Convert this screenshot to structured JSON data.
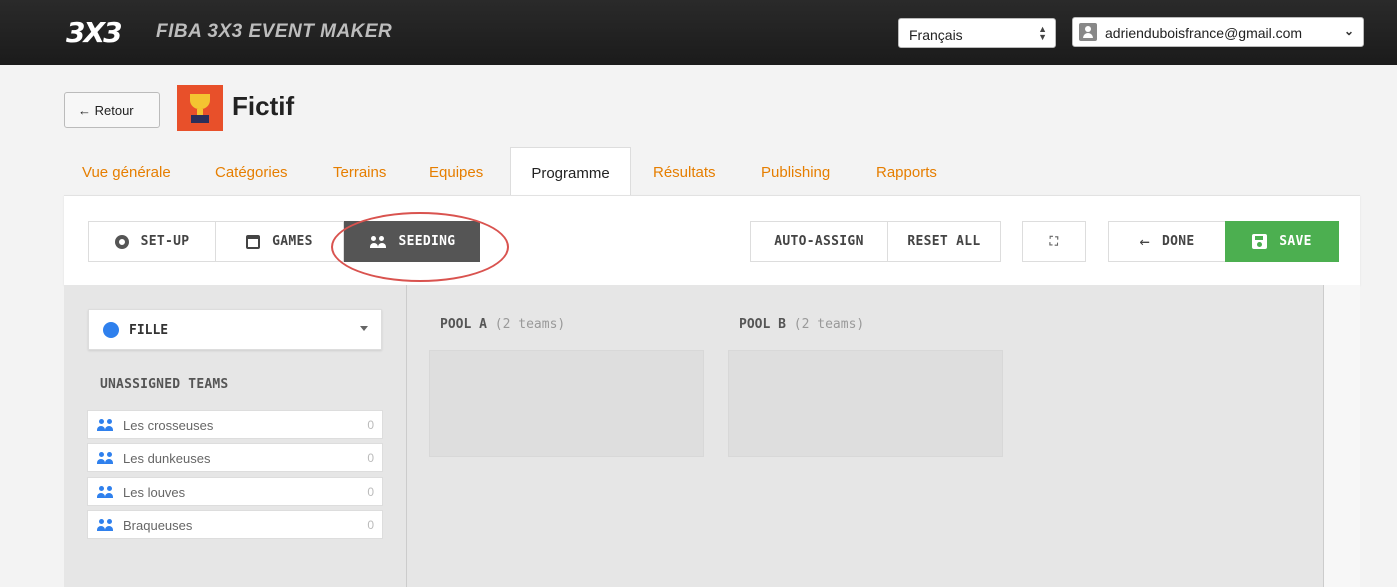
{
  "topbar": {
    "logo": "3X3",
    "brand": "FIBA 3X3 EVENT MAKER",
    "language": "Français",
    "user_email": "adrienduboisfrance@gmail.com"
  },
  "header": {
    "back_label": "← Retour",
    "event_title": "Fictif"
  },
  "tabs": [
    {
      "label": "Vue générale"
    },
    {
      "label": "Catégories"
    },
    {
      "label": "Terrains"
    },
    {
      "label": "Equipes"
    },
    {
      "label": "Programme"
    },
    {
      "label": "Résultats"
    },
    {
      "label": "Publishing"
    },
    {
      "label": "Rapports"
    }
  ],
  "active_tab": "Programme",
  "toolbar": {
    "setup": "SET-UP",
    "games": "GAMES",
    "seeding": "SEEDING",
    "auto_assign": "AUTO-ASSIGN",
    "reset_all": "RESET ALL",
    "done": "DONE",
    "save": "SAVE"
  },
  "category": {
    "selected": "FILLE",
    "color": "#2f80ed"
  },
  "unassigned": {
    "title": "UNASSIGNED TEAMS",
    "teams": [
      {
        "name": "Les crosseuses",
        "count": "0"
      },
      {
        "name": "Les dunkeuses",
        "count": "0"
      },
      {
        "name": "Les louves",
        "count": "0"
      },
      {
        "name": "Braqueuses",
        "count": "0"
      }
    ]
  },
  "pools": [
    {
      "name": "POOL A",
      "info": "(2 teams)"
    },
    {
      "name": "POOL B",
      "info": "(2 teams)"
    }
  ],
  "colors": {
    "tab_link": "#e67e00",
    "save_green": "#4caf50",
    "seeding_active": "#555555",
    "annotation_red": "#d9534f"
  }
}
